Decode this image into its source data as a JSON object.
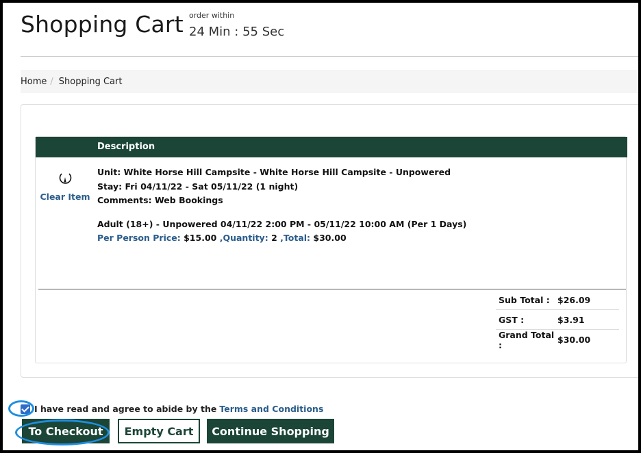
{
  "header": {
    "title": "Shopping Cart",
    "timer_label": "order within",
    "timer_value": "24 Min : 55 Sec"
  },
  "breadcrumb": [
    "Home",
    "Shopping Cart"
  ],
  "cart": {
    "column_header": "Description",
    "clear_item_label": "Clear Item",
    "item": {
      "unit": "Unit: White Horse Hill Campsite - White Horse Hill Campsite - Unpowered",
      "stay": "Stay: Fri 04/11/22 - Sat 05/11/22 (1 night)",
      "comments": "Comments: Web Bookings",
      "line": "Adult (18+) - Unpowered 04/11/22 2:00 PM - 05/11/22 10:00 AM (Per 1 Days)",
      "price_label": "Per Person Price:",
      "price_value": "$15.00",
      "quantity_label": ",Quantity:",
      "quantity_value": "2",
      "total_label": ",Total:",
      "total_value": "$30.00"
    },
    "totals": [
      {
        "label": "Sub Total :",
        "value": "$26.09"
      },
      {
        "label": "GST :",
        "value": "$3.91"
      },
      {
        "label": "Grand Total :",
        "value": "$30.00"
      }
    ]
  },
  "agreement": {
    "text": "I have read and agree to abide by the",
    "link": "Terms and Conditions",
    "checked": true
  },
  "buttons": {
    "checkout": "To Checkout",
    "empty": "Empty Cart",
    "continue": "Continue Shopping"
  },
  "colors": {
    "brand": "#1b4537",
    "link": "#2a5c8a",
    "highlight": "#1e8ee0"
  }
}
